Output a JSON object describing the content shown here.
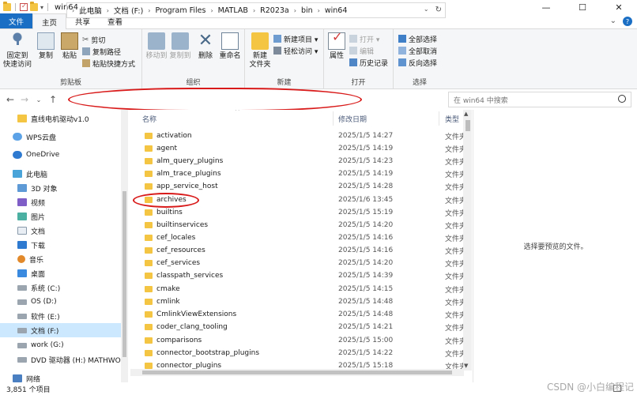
{
  "window": {
    "title": "win64",
    "controls": [
      "—",
      "☐",
      "✕"
    ]
  },
  "ribbon_tabs": {
    "file": "文件",
    "home": "主页",
    "share": "共享",
    "view": "查看"
  },
  "ribbon": {
    "clipboard": {
      "label": "剪贴板",
      "pin": "固定到\n快速访问",
      "pin_l1": "固定到",
      "pin_l2": "快速访问",
      "copy": "复制",
      "paste": "粘贴",
      "cut": "剪切",
      "copy_path": "复制路径",
      "paste_shortcut": "粘贴快捷方式"
    },
    "organize": {
      "label": "组织",
      "move_to": "移动到",
      "copy_to": "复制到",
      "delete": "删除",
      "rename": "重命名"
    },
    "new": {
      "label": "新建",
      "new_folder_l1": "新建",
      "new_folder_l2": "文件夹",
      "new_item": "新建项目 ▾",
      "easy_access": "轻松访问 ▾"
    },
    "open": {
      "label": "打开",
      "properties": "属性",
      "open": "打开 ▾",
      "edit": "编辑",
      "history": "历史记录"
    },
    "select": {
      "label": "选择",
      "select_all": "全部选择",
      "select_none": "全部取消",
      "invert": "反向选择"
    }
  },
  "address": {
    "crumbs": [
      "此电脑",
      "文档 (F:)",
      "Program Files",
      "MATLAB",
      "R2023a",
      "bin",
      "win64"
    ],
    "search_placeholder": "在 win64 中搜索"
  },
  "nav": {
    "items": [
      {
        "label": "直线电机驱动v1.0"
      },
      {
        "label": "WPS云盘"
      },
      {
        "label": "OneDrive"
      },
      {
        "label": "此电脑"
      },
      {
        "label": "3D 对象"
      },
      {
        "label": "视频"
      },
      {
        "label": "图片"
      },
      {
        "label": "文档"
      },
      {
        "label": "下载"
      },
      {
        "label": "音乐"
      },
      {
        "label": "桌面"
      },
      {
        "label": "系统 (C:)"
      },
      {
        "label": "OS (D:)"
      },
      {
        "label": "软件 (E:)"
      },
      {
        "label": "文档 (F:)"
      },
      {
        "label": "work (G:)"
      },
      {
        "label": "DVD 驱动器 (H:) MATHWORKS"
      },
      {
        "label": "网络"
      }
    ]
  },
  "list": {
    "headers": {
      "name": "名称",
      "date": "修改日期",
      "type": "类型"
    },
    "rows": [
      {
        "name": "activation",
        "date": "2025/1/5 14:27",
        "type": "文件夹"
      },
      {
        "name": "agent",
        "date": "2025/1/5 14:19",
        "type": "文件夹"
      },
      {
        "name": "alm_query_plugins",
        "date": "2025/1/5 14:23",
        "type": "文件夹"
      },
      {
        "name": "alm_trace_plugins",
        "date": "2025/1/5 14:19",
        "type": "文件夹"
      },
      {
        "name": "app_service_host",
        "date": "2025/1/5 14:28",
        "type": "文件夹"
      },
      {
        "name": "archives",
        "date": "2025/1/6 13:45",
        "type": "文件夹"
      },
      {
        "name": "builtins",
        "date": "2025/1/5 15:19",
        "type": "文件夹"
      },
      {
        "name": "builtinservices",
        "date": "2025/1/5 14:20",
        "type": "文件夹"
      },
      {
        "name": "cef_locales",
        "date": "2025/1/5 14:16",
        "type": "文件夹"
      },
      {
        "name": "cef_resources",
        "date": "2025/1/5 14:16",
        "type": "文件夹"
      },
      {
        "name": "cef_services",
        "date": "2025/1/5 14:20",
        "type": "文件夹"
      },
      {
        "name": "classpath_services",
        "date": "2025/1/5 14:39",
        "type": "文件夹"
      },
      {
        "name": "cmake",
        "date": "2025/1/5 14:15",
        "type": "文件夹"
      },
      {
        "name": "cmlink",
        "date": "2025/1/5 14:48",
        "type": "文件夹"
      },
      {
        "name": "CmlinkViewExtensions",
        "date": "2025/1/5 14:48",
        "type": "文件夹"
      },
      {
        "name": "coder_clang_tooling",
        "date": "2025/1/5 14:21",
        "type": "文件夹"
      },
      {
        "name": "comparisons",
        "date": "2025/1/5 15:00",
        "type": "文件夹"
      },
      {
        "name": "connector_bootstrap_plugins",
        "date": "2025/1/5 14:22",
        "type": "文件夹"
      },
      {
        "name": "connector_plugins",
        "date": "2025/1/5 15:18",
        "type": "文件夹"
      }
    ]
  },
  "preview": {
    "text": "选择要预览的文件。"
  },
  "status": {
    "count": "3,851 个项目"
  },
  "watermark": "CSDN @小白编程记",
  "colors": {
    "accent": "#1a6fc4",
    "folder": "#f4c542",
    "annotation": "#d91a1a"
  }
}
